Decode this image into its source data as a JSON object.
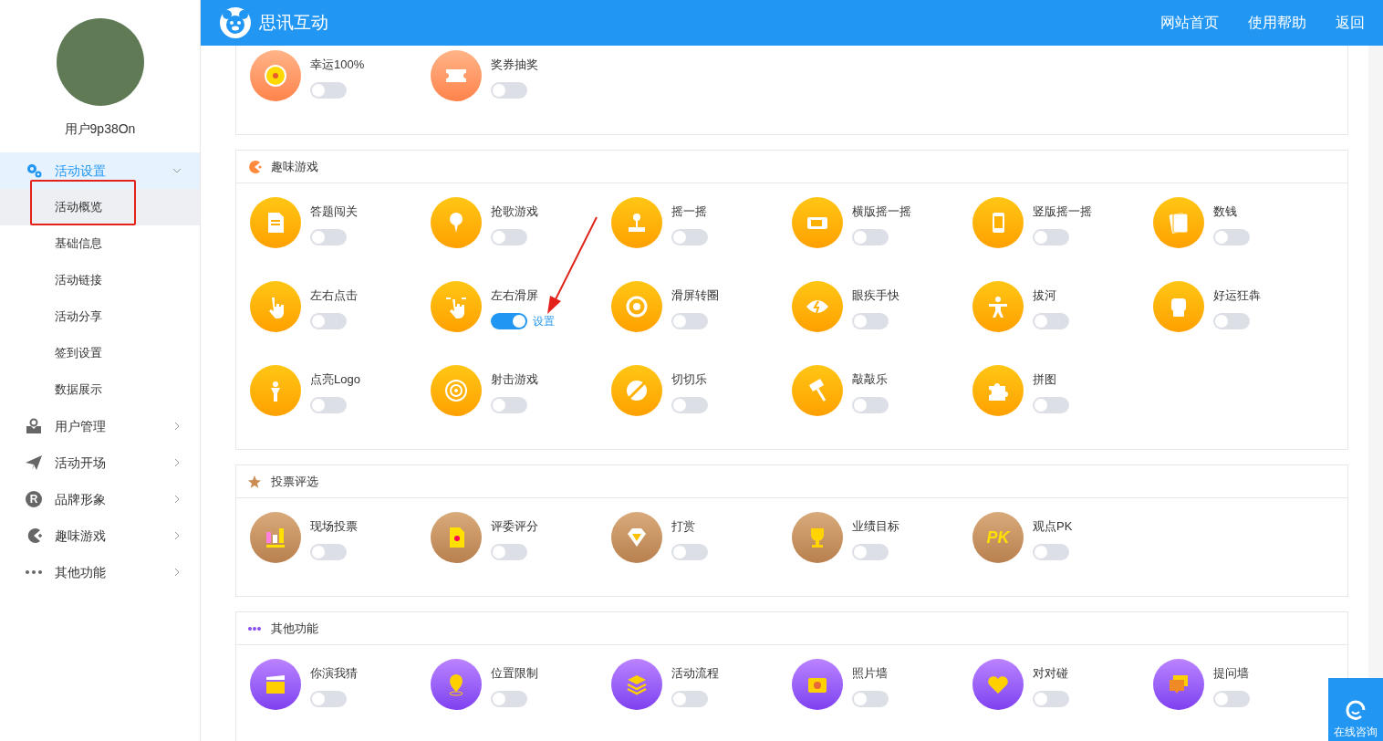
{
  "header": {
    "logo_text": "思讯互动",
    "links": [
      "网站首页",
      "使用帮助",
      "返回"
    ]
  },
  "sidebar": {
    "username": "用户9p38On",
    "menu": [
      {
        "label": "活动设置",
        "expanded": true,
        "selected": true,
        "children": [
          {
            "label": "活动概览",
            "selected": true
          },
          {
            "label": "基础信息",
            "selected": false
          },
          {
            "label": "活动链接",
            "selected": false
          },
          {
            "label": "活动分享",
            "selected": false
          },
          {
            "label": "签到设置",
            "selected": false
          },
          {
            "label": "数据展示",
            "selected": false
          }
        ]
      },
      {
        "label": "用户管理",
        "expanded": false,
        "selected": false
      },
      {
        "label": "活动开场",
        "expanded": false,
        "selected": false
      },
      {
        "label": "品牌形象",
        "expanded": false,
        "selected": false,
        "icon_text": "R"
      },
      {
        "label": "趣味游戏",
        "expanded": false,
        "selected": false
      },
      {
        "label": "其他功能",
        "expanded": false,
        "selected": false
      }
    ]
  },
  "sections": [
    {
      "kind": "lottery",
      "items": [
        {
          "label": "幸运100%",
          "on": false
        },
        {
          "label": "奖券抽奖",
          "on": false
        }
      ]
    },
    {
      "kind": "games",
      "title": "趣味游戏",
      "items": [
        {
          "label": "答题闯关",
          "on": false
        },
        {
          "label": "抢歌游戏",
          "on": false
        },
        {
          "label": "摇一摇",
          "on": false
        },
        {
          "label": "横版摇一摇",
          "on": false
        },
        {
          "label": "竖版摇一摇",
          "on": false
        },
        {
          "label": "数钱",
          "on": false
        },
        {
          "label": "左右点击",
          "on": false
        },
        {
          "label": "左右滑屏",
          "on": true,
          "link": "设置"
        },
        {
          "label": "滑屏转圈",
          "on": false
        },
        {
          "label": "眼疾手快",
          "on": false
        },
        {
          "label": "拔河",
          "on": false
        },
        {
          "label": "好运狂犇",
          "on": false
        },
        {
          "label": "点亮Logo",
          "on": false
        },
        {
          "label": "射击游戏",
          "on": false
        },
        {
          "label": "切切乐",
          "on": false
        },
        {
          "label": "敲敲乐",
          "on": false
        },
        {
          "label": "拼图",
          "on": false
        }
      ]
    },
    {
      "kind": "voting",
      "title": "投票评选",
      "items": [
        {
          "label": "现场投票",
          "on": false
        },
        {
          "label": "评委评分",
          "on": false
        },
        {
          "label": "打赏",
          "on": false
        },
        {
          "label": "业绩目标",
          "on": false
        },
        {
          "label": "观点PK",
          "on": false,
          "icon_text": "PK"
        }
      ]
    },
    {
      "kind": "other",
      "title": "其他功能",
      "items": [
        {
          "label": "你演我猜",
          "on": false
        },
        {
          "label": "位置限制",
          "on": false
        },
        {
          "label": "活动流程",
          "on": false
        },
        {
          "label": "照片墙",
          "on": false
        },
        {
          "label": "对对碰",
          "on": false
        },
        {
          "label": "提问墙",
          "on": false
        }
      ]
    }
  ],
  "chat_button": {
    "label": "在线咨询"
  }
}
